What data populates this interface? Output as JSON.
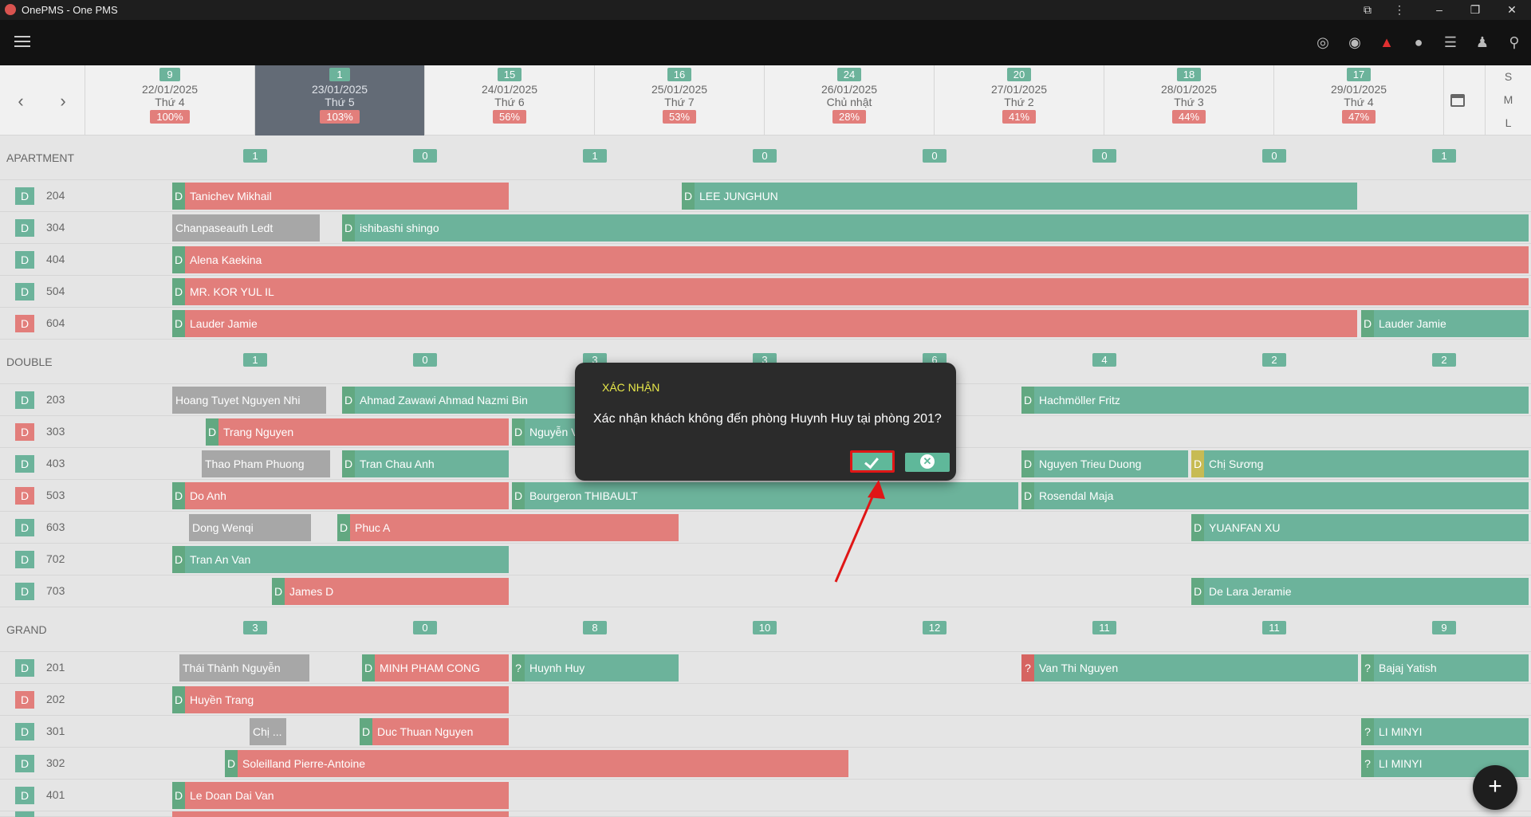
{
  "window": {
    "title": "OnePMS - One PMS"
  },
  "dates": [
    {
      "count": "9",
      "date": "22/01/2025",
      "weekday": "Thứ 4",
      "pct": "100%"
    },
    {
      "count": "1",
      "date": "23/01/2025",
      "weekday": "Thứ 5",
      "pct": "103%"
    },
    {
      "count": "15",
      "date": "24/01/2025",
      "weekday": "Thứ 6",
      "pct": "56%"
    },
    {
      "count": "16",
      "date": "25/01/2025",
      "weekday": "Thứ 7",
      "pct": "53%"
    },
    {
      "count": "24",
      "date": "26/01/2025",
      "weekday": "Chủ nhật",
      "pct": "28%"
    },
    {
      "count": "20",
      "date": "27/01/2025",
      "weekday": "Thứ 2",
      "pct": "41%"
    },
    {
      "count": "18",
      "date": "28/01/2025",
      "weekday": "Thứ 3",
      "pct": "44%"
    },
    {
      "count": "17",
      "date": "29/01/2025",
      "weekday": "Thứ 4",
      "pct": "47%"
    }
  ],
  "sizes": [
    "S",
    "M",
    "L"
  ],
  "categories": {
    "apartment": {
      "name": "APARTMENT",
      "counts": [
        "1",
        "0",
        "1",
        "0",
        "0",
        "0",
        "0",
        "1"
      ]
    },
    "double": {
      "name": "DOUBLE",
      "counts": [
        "1",
        "0",
        "3",
        "3",
        "6",
        "4",
        "2",
        "2"
      ]
    },
    "grand": {
      "name": "GRAND",
      "counts": [
        "3",
        "0",
        "8",
        "10",
        "12",
        "11",
        "11",
        "9"
      ]
    }
  },
  "rooms": {
    "r204": {
      "type": "D",
      "number": "204"
    },
    "r304": {
      "type": "D",
      "number": "304"
    },
    "r404": {
      "type": "D",
      "number": "404"
    },
    "r504": {
      "type": "D",
      "number": "504"
    },
    "r604": {
      "type": "D",
      "number": "604"
    },
    "r203": {
      "type": "D",
      "number": "203"
    },
    "r303": {
      "type": "D",
      "number": "303"
    },
    "r403": {
      "type": "D",
      "number": "403"
    },
    "r503": {
      "type": "D",
      "number": "503"
    },
    "r603": {
      "type": "D",
      "number": "603"
    },
    "r702": {
      "type": "D",
      "number": "702"
    },
    "r703": {
      "type": "D",
      "number": "703"
    },
    "r201": {
      "type": "D",
      "number": "201"
    },
    "r202": {
      "type": "D",
      "number": "202"
    },
    "r301": {
      "type": "D",
      "number": "301"
    },
    "r302": {
      "type": "D",
      "number": "302"
    },
    "r401": {
      "type": "D",
      "number": "401"
    }
  },
  "bookings": {
    "b1": {
      "tag": "D",
      "guest": "Tanichev Mikhail"
    },
    "b2": {
      "tag": "D",
      "guest": "LEE JUNGHUN"
    },
    "b3": {
      "tag": "",
      "guest": "Chanpaseauth Ledt"
    },
    "b4": {
      "tag": "D",
      "guest": "ishibashi shingo"
    },
    "b5": {
      "tag": "D",
      "guest": "Alena Kaekina"
    },
    "b6": {
      "tag": "D",
      "guest": "MR. KOR YUL IL"
    },
    "b7": {
      "tag": "D",
      "guest": "Lauder Jamie"
    },
    "b8": {
      "tag": "D",
      "guest": "Lauder Jamie"
    },
    "b9": {
      "tag": "",
      "guest": "Hoang Tuyet Nguyen Nhi"
    },
    "b10": {
      "tag": "D",
      "guest": "Ahmad Zawawi Ahmad Nazmi Bin"
    },
    "b11": {
      "tag": "D",
      "guest": "Hachmöller Fritz"
    },
    "b12": {
      "tag": "D",
      "guest": "Trang Nguyen"
    },
    "b13": {
      "tag": "D",
      "guest": "Nguyễn V"
    },
    "b14": {
      "tag": "",
      "guest": "Thao Pham Phuong"
    },
    "b15": {
      "tag": "D",
      "guest": "Tran Chau Anh"
    },
    "b16": {
      "tag": "D",
      "guest": "Nguyen Trieu Duong"
    },
    "b17": {
      "tag": "D",
      "guest": "Chị Sương"
    },
    "b18": {
      "tag": "D",
      "guest": "Do Anh"
    },
    "b19": {
      "tag": "D",
      "guest": "Bourgeron THIBAULT"
    },
    "b20": {
      "tag": "D",
      "guest": "Rosendal Maja"
    },
    "b21": {
      "tag": "",
      "guest": "Dong Wenqi"
    },
    "b22": {
      "tag": "D",
      "guest": "Phuc A"
    },
    "b23": {
      "tag": "D",
      "guest": "YUANFAN XU"
    },
    "b24": {
      "tag": "D",
      "guest": "Tran An Van"
    },
    "b25": {
      "tag": "D",
      "guest": "James D"
    },
    "b26": {
      "tag": "D",
      "guest": "De Lara Jeramie"
    },
    "b27": {
      "tag": "",
      "guest": "Thái Thành Nguyễn"
    },
    "b28": {
      "tag": "D",
      "guest": "MINH PHAM CONG"
    },
    "b29": {
      "tag": "?",
      "guest": "Huynh Huy"
    },
    "b30": {
      "tag": "?",
      "guest": "Van Thi Nguyen"
    },
    "b31": {
      "tag": "?",
      "guest": "Bajaj Yatish"
    },
    "b32": {
      "tag": "D",
      "guest": "Huyền Trang"
    },
    "b33": {
      "tag": "",
      "guest": "Chị ..."
    },
    "b34": {
      "tag": "D",
      "guest": "Duc Thuan Nguyen"
    },
    "b35": {
      "tag": "?",
      "guest": "LI MINYI"
    },
    "b36": {
      "tag": "D",
      "guest": "Soleilland Pierre-Antoine"
    },
    "b37": {
      "tag": "?",
      "guest": "LI MINYI"
    },
    "b38": {
      "tag": "D",
      "guest": "Le Doan Dai Van"
    }
  },
  "dialog": {
    "title": "XÁC NHẬN",
    "message": "Xác nhận khách không đến phòng Huynh Huy tại phòng 201?"
  },
  "fab": {
    "label": "+"
  }
}
